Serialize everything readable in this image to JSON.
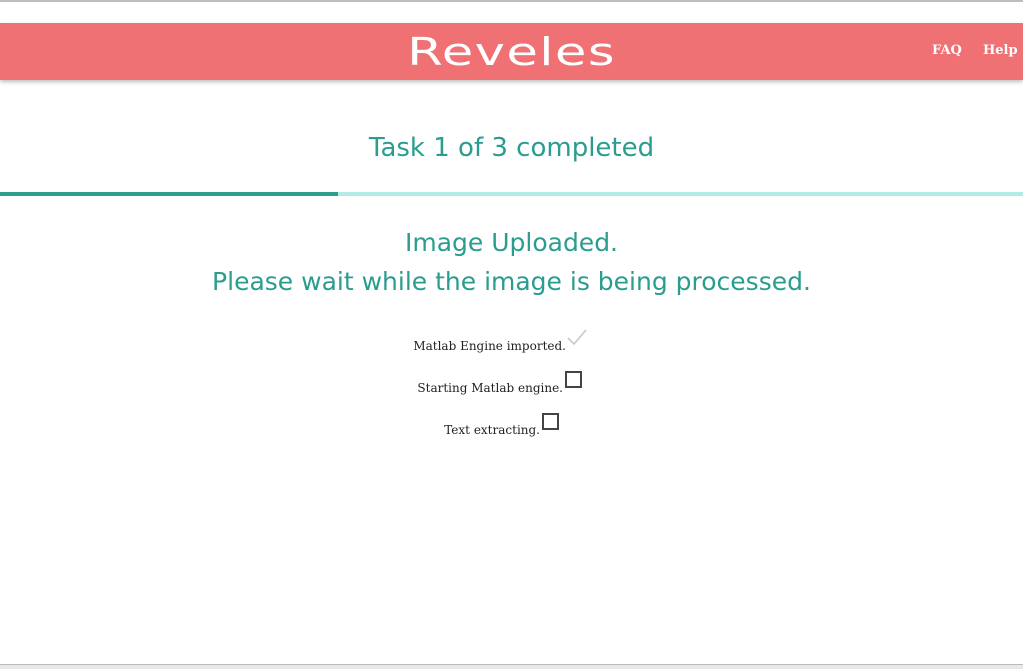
{
  "header": {
    "logo": "Reveles",
    "nav": {
      "faq": "FAQ",
      "help": "Help"
    },
    "colors": {
      "background": "#f07174",
      "text": "#ffffff"
    }
  },
  "progress": {
    "title": "Task 1 of 3 completed",
    "completed": 1,
    "total": 3,
    "fraction": 0.33,
    "colors": {
      "fill": "#2f9c8c",
      "track": "#b2ece4"
    }
  },
  "status": {
    "line1": "Image Uploaded.",
    "line2": "Please wait while the image is being processed.",
    "color": "#2a9d8f"
  },
  "steps": [
    {
      "label": "Matlab Engine imported.",
      "state": "done",
      "icon": "checkmark-icon"
    },
    {
      "label": "Starting Matlab engine.",
      "state": "pending",
      "icon": "checkbox"
    },
    {
      "label": "Text extracting.",
      "state": "pending",
      "icon": "checkbox"
    }
  ]
}
